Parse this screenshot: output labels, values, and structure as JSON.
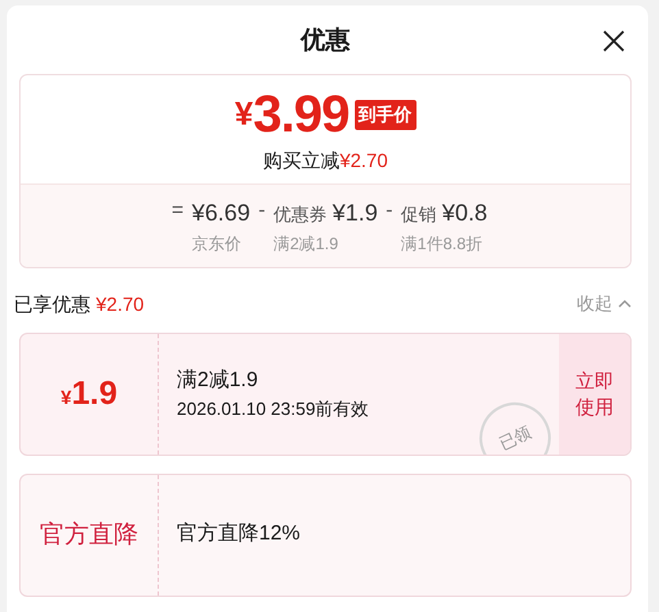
{
  "title": "优惠",
  "summary": {
    "currency": "¥",
    "price": "3.99",
    "price_tag": "到手价",
    "saving_label": "购买立减",
    "saving": "¥2.70",
    "breakdown": [
      {
        "op": "=",
        "amount": "¥6.69",
        "label": "京东价"
      },
      {
        "op": "-",
        "name": "优惠券",
        "amount": "¥1.9",
        "label": "满2减1.9"
      },
      {
        "op": "-",
        "name": "促销",
        "amount": "¥0.8",
        "label": "满1件8.8折"
      }
    ]
  },
  "enjoyed": {
    "label": "已享优惠",
    "amount": "¥2.70",
    "toggle": "收起",
    "expanded": true
  },
  "offers": [
    {
      "kind": "coupon",
      "currency": "¥",
      "value": "1.9",
      "title": "满2减1.9",
      "validity": "2026.01.10 23:59前有效",
      "action": "立即使用",
      "stamp": "已领"
    },
    {
      "kind": "direct",
      "tag": "官方直降",
      "title": "官方直降12%"
    }
  ]
}
